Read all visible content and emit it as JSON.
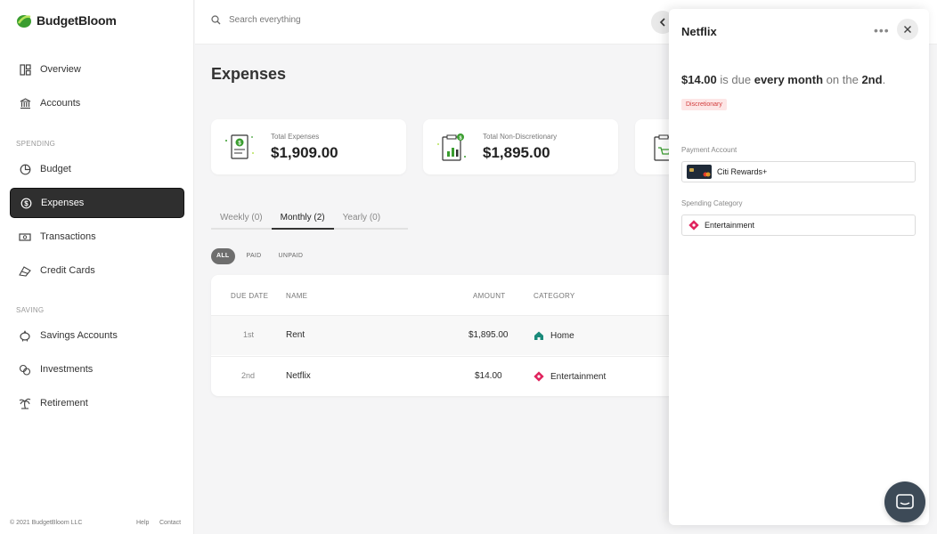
{
  "app": {
    "name": "BudgetBloom"
  },
  "sidebar": {
    "items_top": [
      {
        "label": "Overview",
        "icon": "dashboard-icon"
      },
      {
        "label": "Accounts",
        "icon": "bank-icon"
      }
    ],
    "section_spending": "SPENDING",
    "items_spending": [
      {
        "label": "Budget",
        "icon": "budget-icon"
      },
      {
        "label": "Expenses",
        "icon": "expenses-icon",
        "active": true
      },
      {
        "label": "Transactions",
        "icon": "transactions-icon"
      },
      {
        "label": "Credit Cards",
        "icon": "credit-card-icon"
      }
    ],
    "section_saving": "SAVING",
    "items_saving": [
      {
        "label": "Savings Accounts",
        "icon": "piggy-bank-icon"
      },
      {
        "label": "Investments",
        "icon": "investments-icon"
      },
      {
        "label": "Retirement",
        "icon": "palm-tree-icon"
      }
    ],
    "footer": {
      "copyright": "© 2021 BudgetBloom LLC",
      "help": "Help",
      "contact": "Contact"
    }
  },
  "topbar": {
    "search_placeholder": "Search everything"
  },
  "main": {
    "title": "Expenses",
    "cards": [
      {
        "label": "Total Expenses",
        "value": "$1,909.00"
      },
      {
        "label": "Total Non-Discretionary",
        "value": "$1,895.00"
      }
    ],
    "tabs": [
      "Weekly (0)",
      "Monthly (2)",
      "Yearly (0)"
    ],
    "active_tab": "Monthly (2)",
    "filters": [
      "ALL",
      "PAID",
      "UNPAID"
    ],
    "active_filter": "ALL",
    "table": {
      "headers": [
        "DUE DATE",
        "NAME",
        "AMOUNT",
        "CATEGORY"
      ],
      "rows": [
        {
          "due": "1st",
          "name": "Rent",
          "amount": "$1,895.00",
          "category": "Home"
        },
        {
          "due": "2nd",
          "name": "Netflix",
          "amount": "$14.00",
          "category": "Entertainment"
        }
      ]
    }
  },
  "panel": {
    "title": "Netflix",
    "amount": "$14.00",
    "text_is_due": "is due",
    "frequency": "every month",
    "text_on_the": "on the",
    "day": "2nd",
    "badge": "Discretionary",
    "payment_account_label": "Payment Account",
    "payment_account_value": "Citi Rewards+",
    "spending_category_label": "Spending Category",
    "spending_category_value": "Entertainment"
  },
  "colors": {
    "brand_green": "#3a9d2f",
    "active_nav": "#2f2f2f",
    "badge_red": "#d23c3c",
    "home_teal": "#1a8a7a",
    "entertainment_red": "#e0245e"
  }
}
